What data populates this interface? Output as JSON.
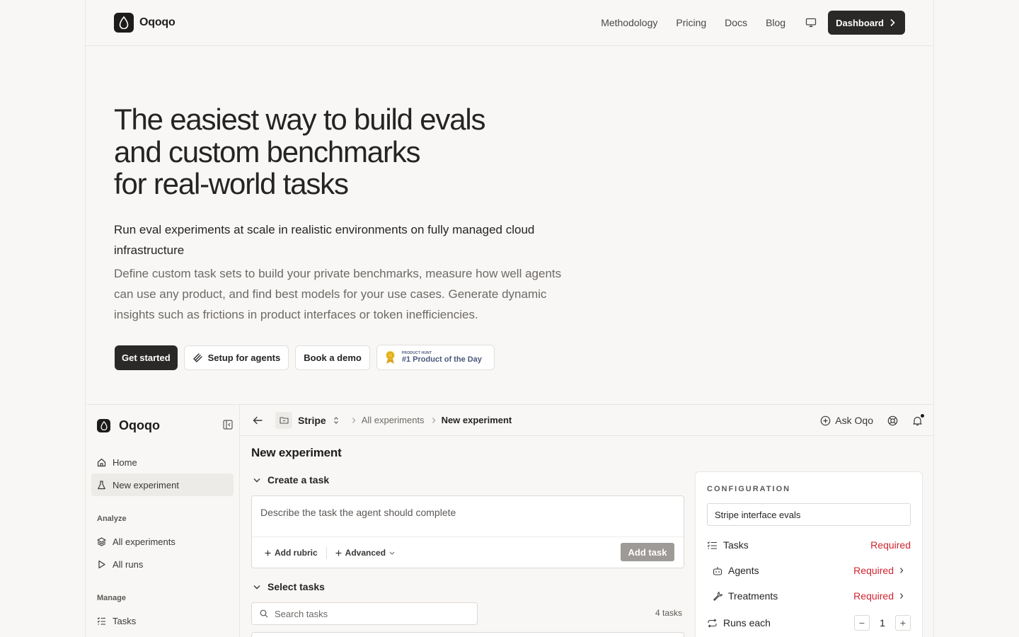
{
  "nav": {
    "brand": "Oqoqo",
    "links": [
      "Methodology",
      "Pricing",
      "Docs",
      "Blog"
    ],
    "dashboard_label": "Dashboard"
  },
  "hero": {
    "title_lines": [
      "The easiest way to build evals",
      "and custom benchmarks",
      "for real-world tasks"
    ],
    "lead": "Run eval experiments at scale in realistic environments on fully managed cloud infrastructure",
    "sub": "Define custom task sets to build your private benchmarks, measure how well agents can use any product, and find best models for your use cases. Generate dynamic insights such as frictions in product interfaces or token inefficiencies.",
    "get_started": "Get started",
    "setup_agents": "Setup for agents",
    "book_demo": "Book a demo",
    "ph_small": "PRODUCT HUNT",
    "ph_big": "#1 Product of the Day"
  },
  "app": {
    "sidebar": {
      "brand": "Oqoqo",
      "home": "Home",
      "new_experiment": "New experiment",
      "analyze": "Analyze",
      "all_experiments": "All experiments",
      "all_runs": "All runs",
      "manage": "Manage",
      "tasks": "Tasks"
    },
    "topbar": {
      "project": "Stripe",
      "crumb": "All experiments",
      "current": "New experiment",
      "ask": "Ask Oqo"
    },
    "main": {
      "title": "New experiment",
      "create_task": "Create a task",
      "task_placeholder": "Describe the task the agent should complete",
      "add_rubric": "Add rubric",
      "advanced": "Advanced",
      "add_task": "Add task",
      "select_tasks": "Select tasks",
      "search_placeholder": "Search tasks",
      "task_count": "4 tasks"
    },
    "config": {
      "title": "CONFIGURATION",
      "name": "Stripe interface evals",
      "tasks": "Tasks",
      "agents": "Agents",
      "treatments": "Treatments",
      "required": "Required",
      "runs_each": "Runs each",
      "runs_value": "1",
      "minus": "−",
      "plus": "+"
    }
  },
  "colors": {
    "accent_dark": "#2b2928",
    "required_red": "#d1242f",
    "background": "#f8f7f5"
  }
}
